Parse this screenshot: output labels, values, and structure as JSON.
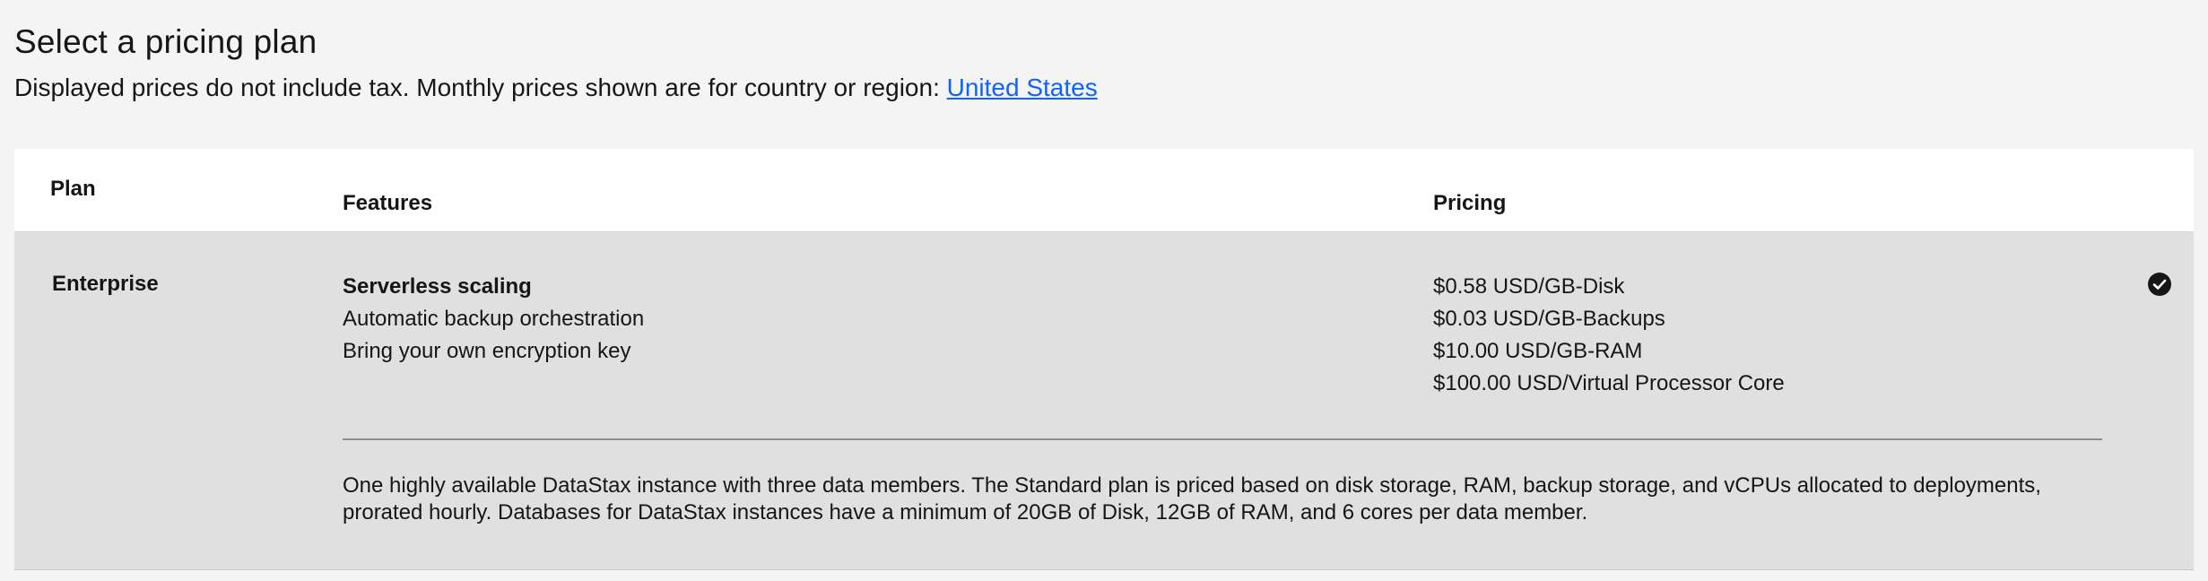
{
  "header": {
    "title": "Select a pricing plan",
    "subtitle_text": "Displayed prices do not include tax. Monthly prices shown are for country or region: ",
    "region_link": "United States"
  },
  "table": {
    "columns": [
      "Plan",
      "Features",
      "Pricing"
    ],
    "rows": [
      {
        "plan": "Enterprise",
        "selected": true,
        "features": [
          "Serverless scaling",
          "Automatic backup orchestration",
          "Bring your own encryption key"
        ],
        "pricing": [
          "$0.58 USD/GB-Disk",
          "$0.03 USD/GB-Backups",
          "$10.00 USD/GB-RAM",
          "$100.00 USD/Virtual Processor Core"
        ],
        "description": "One highly available DataStax instance with three data members. The Standard plan is priced based on disk storage, RAM, backup storage, and vCPUs allocated to deployments, prorated hourly. Databases for DataStax instances have a minimum of 20GB of Disk, 12GB of RAM, and 6 cores per data member."
      }
    ]
  },
  "colors": {
    "page_bg": "#f4f4f4",
    "header_bg": "#ffffff",
    "selected_row_bg": "#e0e0e0",
    "link": "#0f62fe",
    "text": "#161616"
  },
  "icons": {
    "selected": "checkmark-filled-icon"
  }
}
